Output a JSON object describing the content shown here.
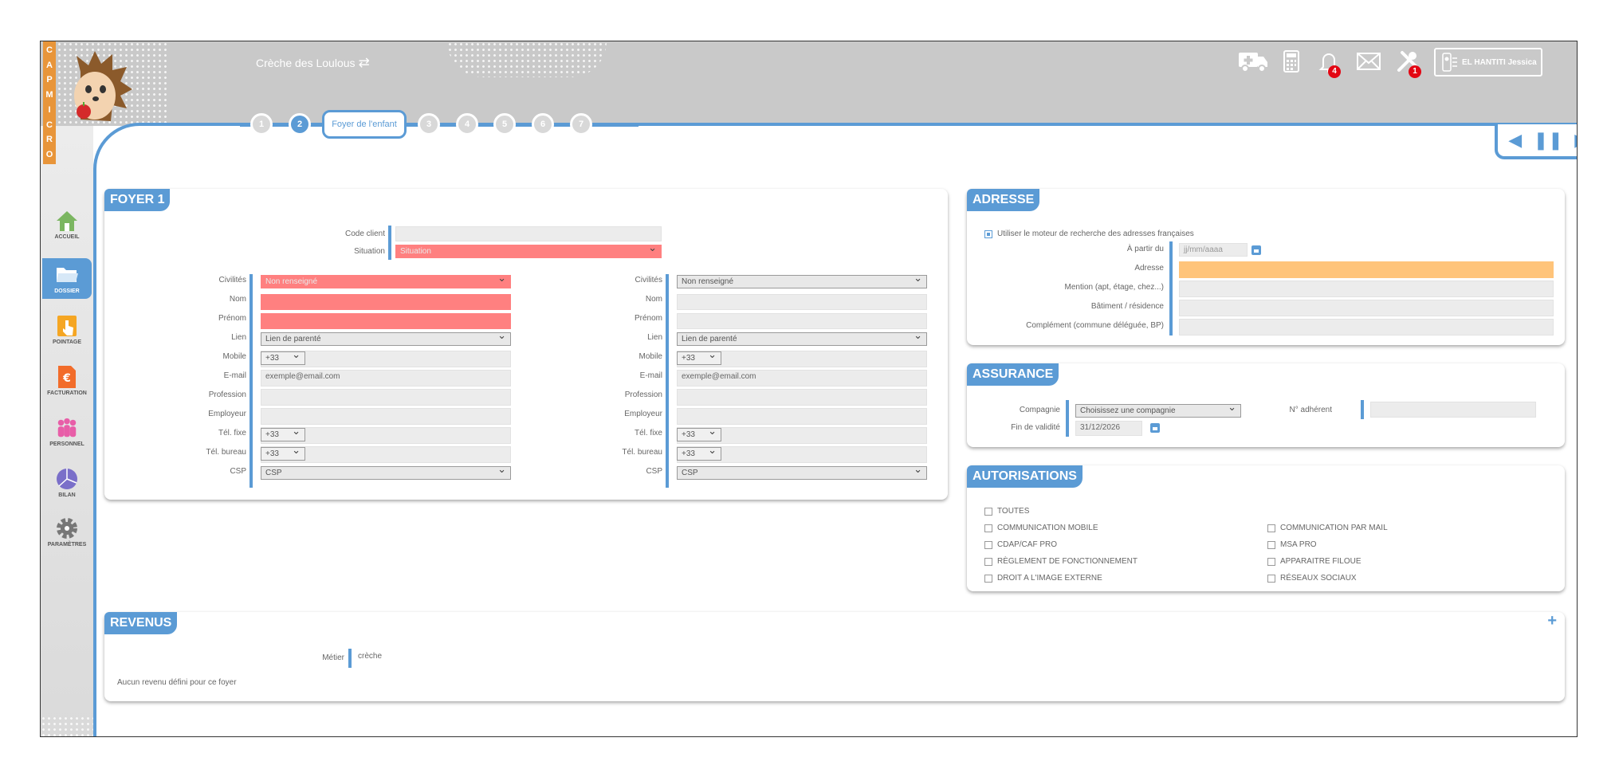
{
  "header": {
    "brand_letters": [
      "C",
      "A",
      "P",
      "M",
      "I",
      "C",
      "R",
      "O"
    ],
    "creche_name": "Crèche des Loulous",
    "switch_icon": "⇄",
    "notifications_count": "4",
    "tools_count": "1",
    "user_name": "EL HANTITI Jessica"
  },
  "steps": [
    {
      "label": "1"
    },
    {
      "label": "2"
    },
    {
      "label": "Foyer de l'enfant"
    },
    {
      "label": "3"
    },
    {
      "label": "4"
    },
    {
      "label": "5"
    },
    {
      "label": "6"
    },
    {
      "label": "7"
    }
  ],
  "sidebar": {
    "items": [
      {
        "label": "ACCUEIL",
        "icon": "house-icon"
      },
      {
        "label": "DOSSIER",
        "icon": "folder-icon"
      },
      {
        "label": "POINTAGE",
        "icon": "pointage-icon"
      },
      {
        "label": "FACTURATION",
        "icon": "invoice-icon"
      },
      {
        "label": "PERSONNEL",
        "icon": "people-icon"
      },
      {
        "label": "BILAN",
        "icon": "pie-icon"
      },
      {
        "label": "PARAMÈTRES",
        "icon": "gear-icon"
      }
    ]
  },
  "foyer": {
    "title": "FOYER 1",
    "code_client_label": "Code client",
    "situation_label": "Situation",
    "situation_value": "Situation",
    "parents": [
      {
        "civilites_label": "Civilités",
        "civilites_value": "Non renseigné",
        "nom_label": "Nom",
        "prenom_label": "Prénom",
        "lien_label": "Lien",
        "lien_value": "Lien de parenté",
        "mobile_label": "Mobile",
        "mobile_code": "+33",
        "email_label": "E-mail",
        "email_placeholder": "exemple@email.com",
        "profession_label": "Profession",
        "employeur_label": "Employeur",
        "tel_fixe_label": "Tél. fixe",
        "tel_fixe_code": "+33",
        "tel_bureau_label": "Tél. bureau",
        "tel_bureau_code": "+33",
        "csp_label": "CSP",
        "csp_value": "CSP"
      },
      {
        "civilites_label": "Civilités",
        "civilites_value": "Non renseigné",
        "nom_label": "Nom",
        "prenom_label": "Prénom",
        "lien_label": "Lien",
        "lien_value": "Lien de parenté",
        "mobile_label": "Mobile",
        "mobile_code": "+33",
        "email_label": "E-mail",
        "email_placeholder": "exemple@email.com",
        "profession_label": "Profession",
        "employeur_label": "Employeur",
        "tel_fixe_label": "Tél. fixe",
        "tel_fixe_code": "+33",
        "tel_bureau_label": "Tél. bureau",
        "tel_bureau_code": "+33",
        "csp_label": "CSP",
        "csp_value": "CSP"
      }
    ]
  },
  "adresse": {
    "title": "ADRESSE",
    "moteur_label": "Utiliser le moteur de recherche des adresses françaises",
    "a_partir_label": "À partir du",
    "a_partir_placeholder": "jj/mm/aaaa",
    "adresse_label": "Adresse",
    "mention_label": "Mention (apt, étage, chez...)",
    "batiment_label": "Bâtiment / résidence",
    "complement_label": "Complément (commune déléguée, BP)"
  },
  "assurance": {
    "title": "ASSURANCE",
    "compagnie_label": "Compagnie",
    "compagnie_value": "Choisissez une compagnie",
    "adherent_label": "N° adhérent",
    "fin_validite_label": "Fin de validité",
    "fin_validite_value": "31/12/2026"
  },
  "autorisations": {
    "title": "AUTORISATIONS",
    "toutes": "TOUTES",
    "items": [
      "COMMUNICATION MOBILE",
      "COMMUNICATION PAR MAIL",
      "CDAP/CAF PRO",
      "MSA PRO",
      "RÈGLEMENT DE FONCTIONNEMENT",
      "APPARAITRE FILOUE",
      "DROIT A L'IMAGE EXTERNE",
      "RÉSEAUX SOCIAUX"
    ]
  },
  "revenus": {
    "title": "REVENUS",
    "add": "+",
    "metier_label": "Métier",
    "metier_value": "crèche",
    "empty_text": "Aucun revenu défini pour ce foyer"
  },
  "colors": {
    "accent": "#5b9bd5",
    "required": "#ff8080",
    "warning": "#ffc47a",
    "badge": "#e30613"
  }
}
